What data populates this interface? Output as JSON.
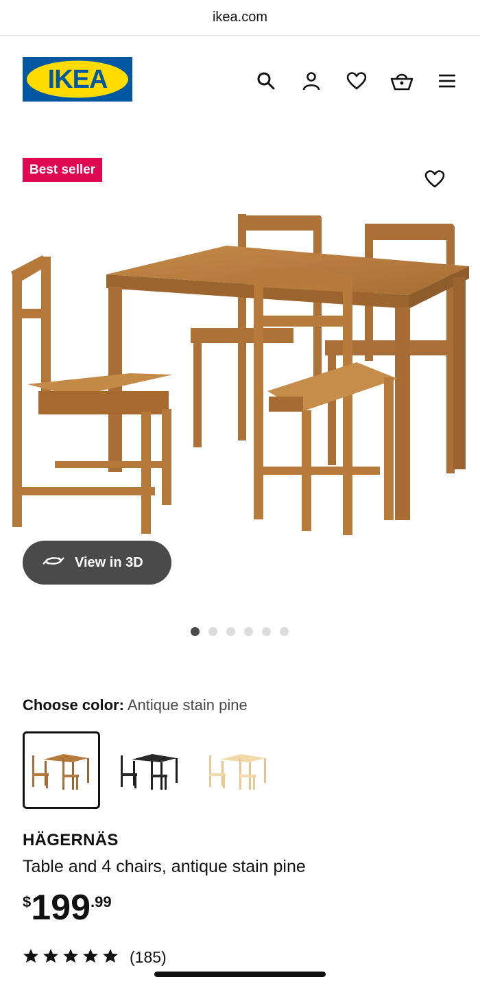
{
  "browser": {
    "url": "ikea.com"
  },
  "header": {
    "logo_text": "IKEA",
    "icons": [
      "search-icon",
      "account-icon",
      "heart-icon",
      "basket-icon",
      "menu-icon"
    ]
  },
  "badge": {
    "label": "Best seller"
  },
  "gallery": {
    "view_3d_label": "View in 3D",
    "dots_total": 6,
    "dots_active_index": 0
  },
  "color": {
    "label": "Choose color:",
    "value": "Antique stain pine",
    "options": [
      "antique-stain-pine",
      "black",
      "pine"
    ],
    "selected_index": 0
  },
  "product": {
    "name": "HÄGERNÄS",
    "description": "Table and 4 chairs, antique stain pine",
    "price_currency": "$",
    "price_integer": "199",
    "price_decimal": ".99"
  },
  "rating": {
    "stars": 5,
    "count": "(185)"
  },
  "colors": {
    "badge": "#e00751",
    "wood": "#b67a3c",
    "button_dark": "#4a4a4a",
    "ikea_blue": "#0058a3",
    "ikea_yellow": "#ffdb00"
  }
}
